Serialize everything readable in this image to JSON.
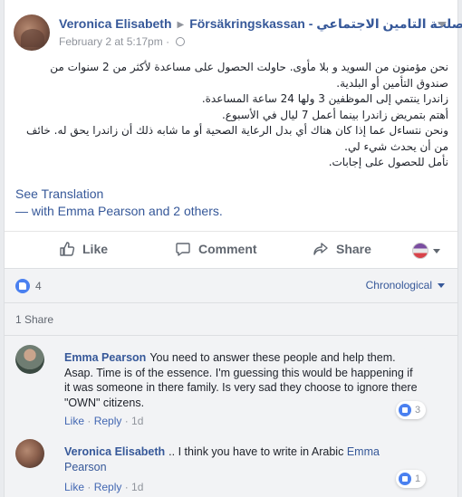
{
  "post": {
    "author": "Veronica Elisabeth",
    "target_page": "Försäkringskassan - مصلحة التامين الاجتماعي",
    "timestamp": "February 2 at 5:17pm",
    "body_lines": [
      "نحن مؤمنون من السويد و بلا مأوى. حاولت الحصول على مساعدة لأكثر من 2 سنوات من صندوق التأمين أو البلدية.",
      "زاندرا ينتمي إلى الموظفين 3 ولها 24 ساعة المساعدة.",
      "أهتم بتمريض زاندرا بينما أعمل 7 ليال في الأسبوع.",
      "ونحن نتساءل عما إذا كان هناك أي بدل الرعاية الصحية أو ما شابه ذلك أن زاندرا يحق له. خائف من أن يحدث شيء لي.",
      "نأمل للحصول على إجابات."
    ],
    "see_translation": "See Translation",
    "with_tags": "— with Emma Pearson and 2 others."
  },
  "actions": {
    "like": "Like",
    "comment": "Comment",
    "share": "Share"
  },
  "reactions": {
    "count": "4",
    "order": "Chronological",
    "shares": "1 Share"
  },
  "comments": [
    {
      "author": "Emma Pearson",
      "text": "You need to answer these people and help them. Asap. Time is of the essence. I'm guessing this would be happening if it was someone in there family. Is very sad they choose to ignore there \"OWN\" citizens.",
      "like": "Like",
      "reply": "Reply",
      "age": "1d",
      "likes": "3"
    },
    {
      "author": "Veronica Elisabeth",
      "text": ".. I think you have to write in Arabic",
      "tag": "Emma Pearson",
      "like": "Like",
      "reply": "Reply",
      "age": "1d",
      "likes": "1"
    }
  ],
  "colors": {
    "link": "#365899",
    "meta": "#90949c",
    "like_blue": "#4a80f0"
  }
}
